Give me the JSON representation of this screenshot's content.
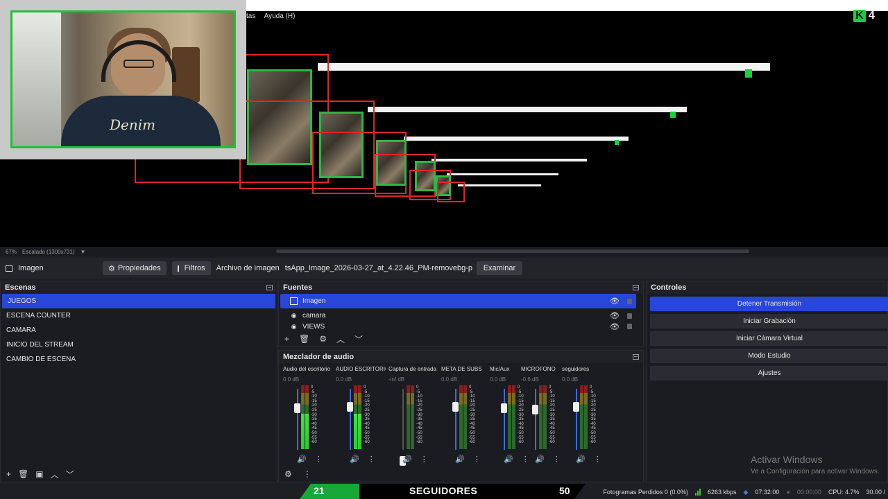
{
  "menu": {
    "items": [
      "tas",
      "Ayuda (H)"
    ]
  },
  "overlay": {
    "logo_letter": "K",
    "logo_number": "4"
  },
  "webcam": {
    "shirt_text": "Denim"
  },
  "preview_status": {
    "zoom": "67%",
    "scaling": "Escalado (1300x731)"
  },
  "source_toolbar": {
    "source_name": "Imagen",
    "properties_label": "Propiedades",
    "filters_label": "Filtros",
    "file_label": "Archivo de imagen",
    "file_path": "tsApp_Image_2026-03-27_at_4.22.46_PM-removebg-preview.png",
    "browse_label": "Examinar"
  },
  "scenes": {
    "title": "Escenas",
    "items": [
      "JUEGOS",
      "ESCENA COUNTER",
      "CAMARA",
      "INICIO DEL STREAM",
      "CAMBIO DE ESCENA"
    ]
  },
  "sources": {
    "title": "Fuentes",
    "items": [
      "Imagen",
      "camara",
      "VIEWS"
    ]
  },
  "mixer": {
    "title": "Mezclador de audio",
    "channels": [
      {
        "name": "Audio del escritorio",
        "db": "0.0 dB",
        "level": 0.55
      },
      {
        "name": "AUDIO ESCRITORIO",
        "db": "0.0 dB",
        "level": 0.55
      },
      {
        "name": "Captura de entrada",
        "db": "-inf dB",
        "level": 0
      },
      {
        "name": "META DE SUBS",
        "db": "0.0 dB",
        "level": 0
      },
      {
        "name": "Mic/Aux",
        "db": "0.0 dB",
        "level": 0
      },
      {
        "name": "MICROFONO",
        "db": "-0.6 dB",
        "level": 0
      },
      {
        "name": "seguidores",
        "db": "0.0 dB",
        "level": 0
      }
    ],
    "scale": [
      "0",
      "-5",
      "-10",
      "-15",
      "-20",
      "-25",
      "-30",
      "-35",
      "-40",
      "-45",
      "-50",
      "-55",
      "-60"
    ]
  },
  "controls": {
    "title": "Controles",
    "buttons": [
      "Detener Transmisión",
      "Iniciar Grabación",
      "Iniciar Cámara Virtual",
      "Modo Estudio",
      "Ajustes"
    ]
  },
  "activate_windows": {
    "title": "Activar Windows",
    "subtitle": "Ve a Configuración para activar Windows."
  },
  "followers": {
    "current": "21",
    "label": "SEGUIDORES",
    "goal": "50"
  },
  "status": {
    "dropped_frames": "Fotogramas Perdidos 0 (0.0%)",
    "bitrate": "6263 kbps",
    "stream_time": "07:32:00",
    "record_time": "00:00:00",
    "cpu": "CPU: 4.7%",
    "fps": "30.00 /"
  },
  "colors": {
    "accent": "#2846d8",
    "brand_green": "#18d13b",
    "background": "#1b1c21"
  }
}
